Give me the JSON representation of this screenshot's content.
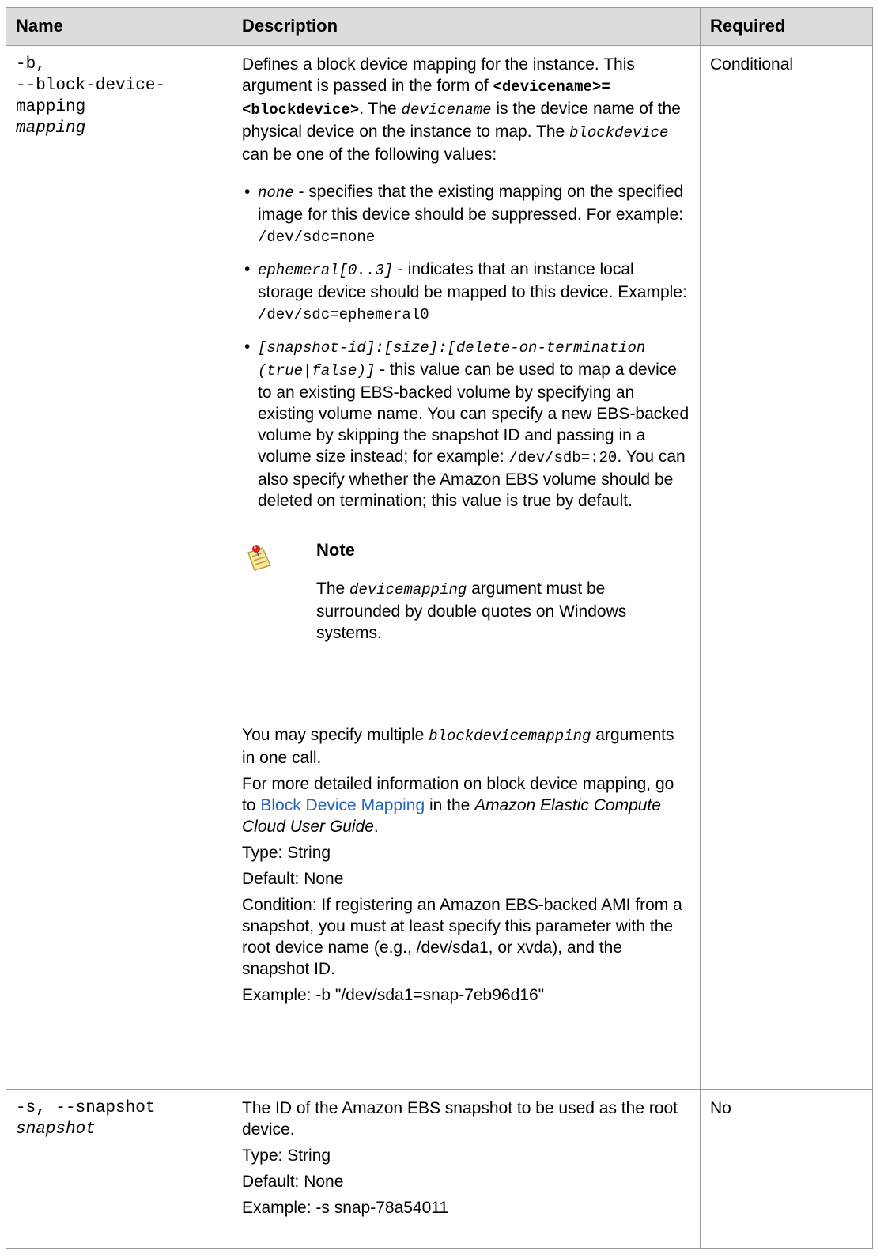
{
  "headers": {
    "name": "Name",
    "description": "Description",
    "required": "Required"
  },
  "rows": [
    {
      "name_lines": [
        "-b,",
        "--block-device-mapping"
      ],
      "name_arg": "mapping",
      "required": "Conditional",
      "intro": {
        "t1": "Defines a block device mapping for the instance. This argument is passed in the form of ",
        "form": "<devicename>=<blockdevice>",
        "t2": ". The ",
        "devicename": "devicename",
        "t3": " is the device name of the physical device on the instance to map. The ",
        "blockdevice": "blockdevice",
        "t4": " can be one of the following values:"
      },
      "values": [
        {
          "code": "none",
          "text": " - specifies that the existing mapping on the specified image for this device should be suppressed. For example: ",
          "example": "/dev/sdc=none",
          "tail": ""
        },
        {
          "code": "ephemeral[0..3]",
          "text": " - indicates that an instance local storage device should be mapped to this device. Example: ",
          "example": "/dev/sdc=ephemeral0",
          "tail": ""
        },
        {
          "code": "[snapshot-id]:[size]:[delete-on-termination (true|false)]",
          "text": " - this value can be used to map a device to an existing EBS-backed volume by specifying an existing volume name. You can specify a new EBS-backed volume by skipping the snapshot ID and passing in a volume size instead; for example: ",
          "example": "/dev/sdb=:20",
          "tail": ". You can also specify whether the Amazon EBS volume should be deleted on termination; this value is true by default."
        }
      ],
      "note": {
        "title": "Note",
        "body_pre": "The ",
        "body_code": "devicemapping",
        "body_post": " argument must be surrounded by double quotes on Windows systems."
      },
      "multi": {
        "pre": "You may specify multiple ",
        "code": "blockdevicemapping",
        "post": " arguments in one call."
      },
      "more": {
        "pre": "For more detailed information on block device mapping, go to ",
        "link": "Block Device Mapping",
        "mid": " in the ",
        "guide": "Amazon Elastic Compute Cloud User Guide",
        "post": "."
      },
      "type": "Type: String",
      "default": "Default: None",
      "condition": "Condition: If registering an Amazon EBS-backed AMI from a snapshot, you must at least specify this parameter with the root device name (e.g., /dev/sda1, or xvda), and the snapshot ID.",
      "example": "Example: -b \"/dev/sda1=snap-7eb96d16\""
    },
    {
      "name_lines": [
        "-s, --snapshot"
      ],
      "name_arg": "snapshot",
      "required": "No",
      "desc": "The ID of the Amazon EBS snapshot to be used as the root device.",
      "type": "Type: String",
      "default": "Default: None",
      "example": "Example: -s snap-78a54011"
    }
  ],
  "icons": {
    "note": "note-pushpin-icon"
  }
}
